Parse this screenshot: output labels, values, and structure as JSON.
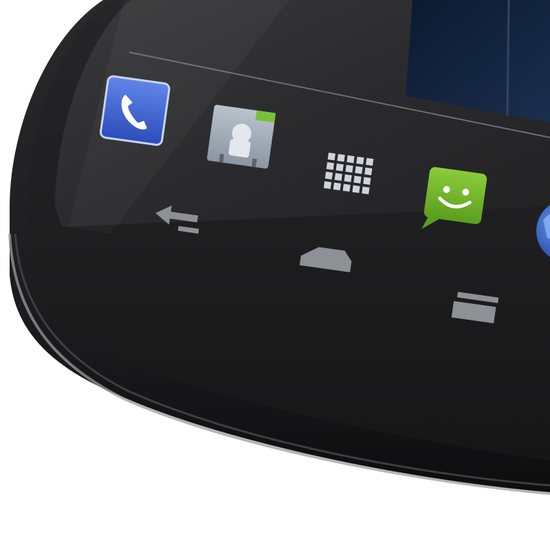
{
  "scene": {
    "description_visible_text": ""
  },
  "dock": {
    "icons": [
      {
        "name": "phone-icon",
        "color": "#3a5fd0"
      },
      {
        "name": "contacts-icon",
        "color": "#9aa6b2"
      },
      {
        "name": "app-drawer-icon",
        "color": "#cfd4dc"
      },
      {
        "name": "messaging-icon",
        "color": "#6fb52c"
      },
      {
        "name": "browser-icon",
        "color": "#2a54c8"
      }
    ]
  },
  "navbar": {
    "buttons": [
      {
        "name": "back-icon"
      },
      {
        "name": "home-icon"
      },
      {
        "name": "recent-apps-icon"
      }
    ]
  },
  "colors": {
    "background": "#ffffff",
    "phone_body": "#1b1b1d",
    "screen": "#242426",
    "wallpaper_panel": "#10203a",
    "nav_icon": "#8d9196"
  }
}
